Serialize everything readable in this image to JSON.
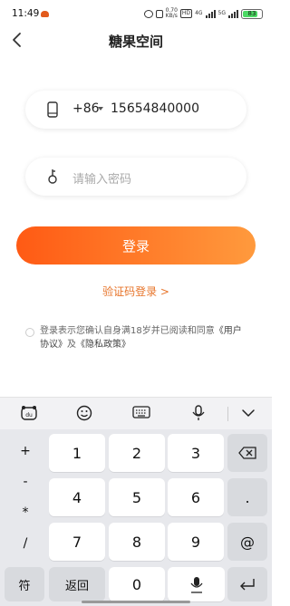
{
  "status_bar": {
    "time": "11:49",
    "net_speed": "0.70",
    "net_unit": "KB/s",
    "hd": "HD",
    "net1": "4G",
    "net2": "5G",
    "battery": "83"
  },
  "header": {
    "title": "糖果空间"
  },
  "phone_field": {
    "country_code": "+86",
    "number": "15654840000"
  },
  "password_field": {
    "placeholder": "请输入密码"
  },
  "login_button": {
    "label": "登录"
  },
  "code_login": {
    "label": "验证码登录 >"
  },
  "agreement": {
    "prefix": "登录表示您确认自身满18岁并已阅读和同意",
    "user_agreement": "《用户协议》",
    "and": "及",
    "privacy_policy": "《隐私政策》"
  },
  "keyboard": {
    "side_symbols": [
      "+",
      "-",
      "*",
      "/"
    ],
    "digits": [
      "1",
      "2",
      "3",
      "4",
      "5",
      "6",
      "7",
      "8",
      "9",
      "0"
    ],
    "right_keys": [
      ".",
      "@"
    ],
    "symbols_label": "符",
    "back_label": "返回"
  }
}
